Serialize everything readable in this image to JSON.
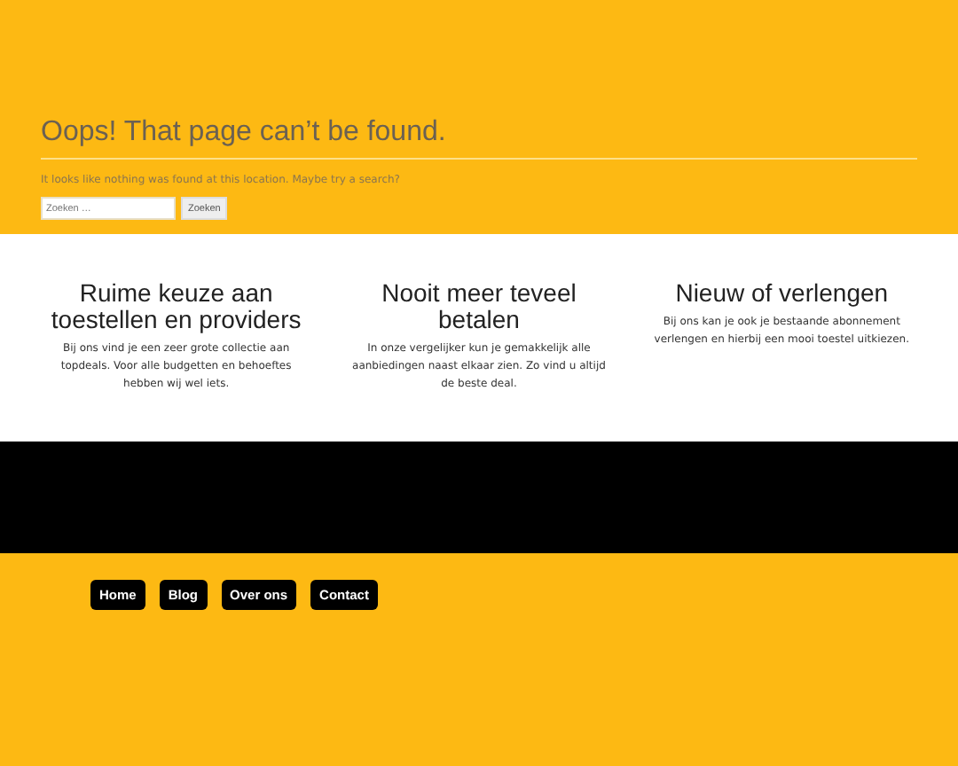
{
  "error": {
    "title": "Oops! That page can’t be found.",
    "message": "It looks like nothing was found at this location. Maybe try a search?",
    "search": {
      "placeholder": "Zoeken …",
      "button": "Zoeken"
    }
  },
  "features": [
    {
      "title": "Ruime keuze aan toestellen en providers",
      "text": "Bij ons vind je een zeer grote collectie aan topdeals. Voor alle budgetten en behoeftes hebben wij wel iets."
    },
    {
      "title": "Nooit meer teveel betalen",
      "text": "In onze vergelijker kun je gemakkelijk alle aanbiedingen naast elkaar zien. Zo vind u altijd de beste deal."
    },
    {
      "title": "Nieuw of verlengen",
      "text": "Bij ons kan je ook je bestaande abonnement verlengen en hierbij een mooi toestel uitkiezen."
    }
  ],
  "footer_menu": [
    "Home",
    "Blog",
    "Over ons",
    "Contact"
  ]
}
